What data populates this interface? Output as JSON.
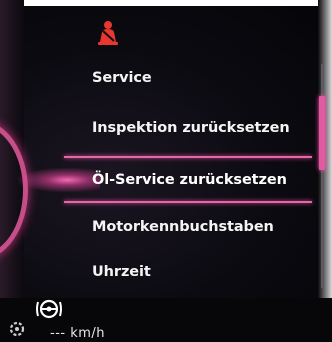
{
  "menu": {
    "items": [
      {
        "label": "Service"
      },
      {
        "label": "Inspektion zurücksetzen"
      },
      {
        "label": "Öl-Service zurücksetzen"
      },
      {
        "label": "Motorkennbuchstaben"
      },
      {
        "label": "Uhrzeit"
      }
    ],
    "selected_index": 2
  },
  "status": {
    "speed_value": "---",
    "speed_unit": "km/h"
  },
  "icons": {
    "warning": "seatbelt-warning-icon",
    "assist": "steering-assist-icon",
    "status": "gear-status-icon"
  },
  "colors": {
    "accent": "#e05aa4",
    "warning": "#e8372f",
    "background": "#0b0a10",
    "text": "#f4f4f4"
  }
}
